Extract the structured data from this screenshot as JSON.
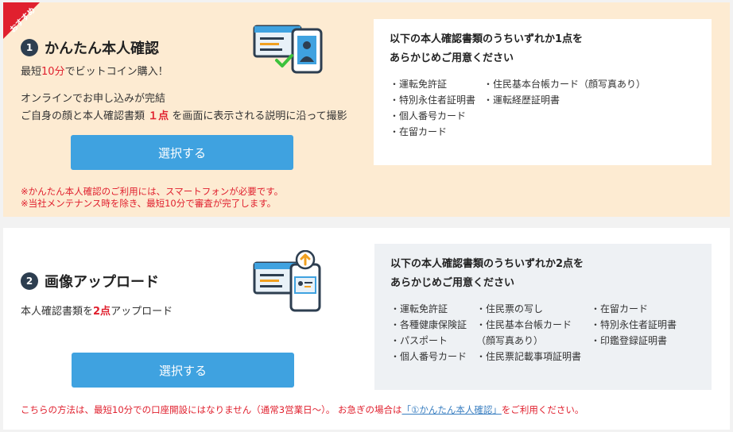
{
  "card1": {
    "ribbon": "おすすめ",
    "number": "1",
    "title": "かんたん本人確認",
    "subtitle_pre": "最短",
    "subtitle_red": "10分",
    "subtitle_post": "でビットコイン購入！",
    "online": "オンラインでお申し込みが完結",
    "instr_pre": "ご自身の顔と本人確認書類",
    "instr_red": "１点",
    "instr_post": "を画面に表示される説明に沿って撮影",
    "button": "選択する",
    "note1": "※かんたん本人確認のご利用には、スマートフォンが必要です。",
    "note2": "※当社メンテナンス時を除き、最短10分で審査が完了します。",
    "docs": {
      "heading1": "以下の本人確認書類のうちいずれか1点を",
      "heading2": "あらかじめご用意ください",
      "col1": [
        "・運転免許証",
        "・特別永住者証明書",
        "・個人番号カード",
        "・在留カード"
      ],
      "col2": [
        "・住民基本台帳カード（顔写真あり）",
        "・運転経歴証明書"
      ]
    }
  },
  "card2": {
    "number": "2",
    "title": "画像アップロード",
    "desc_pre": "本人確認書類を",
    "desc_red": "2点",
    "desc_post": "アップロード",
    "button": "選択する",
    "note_pre": "こちらの方法は、最短10分での口座開設にはなりません（通常3営業日〜）。 お急ぎの場合は",
    "note_link": "「①かんたん本人確認」",
    "note_post": "をご利用ください。",
    "docs": {
      "heading1": "以下の本人確認書類のうちいずれか2点を",
      "heading2": "あらかじめご用意ください",
      "col1": [
        "・運転免許証",
        "・各種健康保険証",
        "・パスポート",
        "・個人番号カード"
      ],
      "col2": [
        "・住民票の写し",
        "・住民基本台帳カード",
        "（顔写真あり）",
        "・住民票記載事項証明書"
      ],
      "col3": [
        "・在留カード",
        "・特別永住者証明書",
        "・印鑑登録証明書"
      ]
    }
  }
}
